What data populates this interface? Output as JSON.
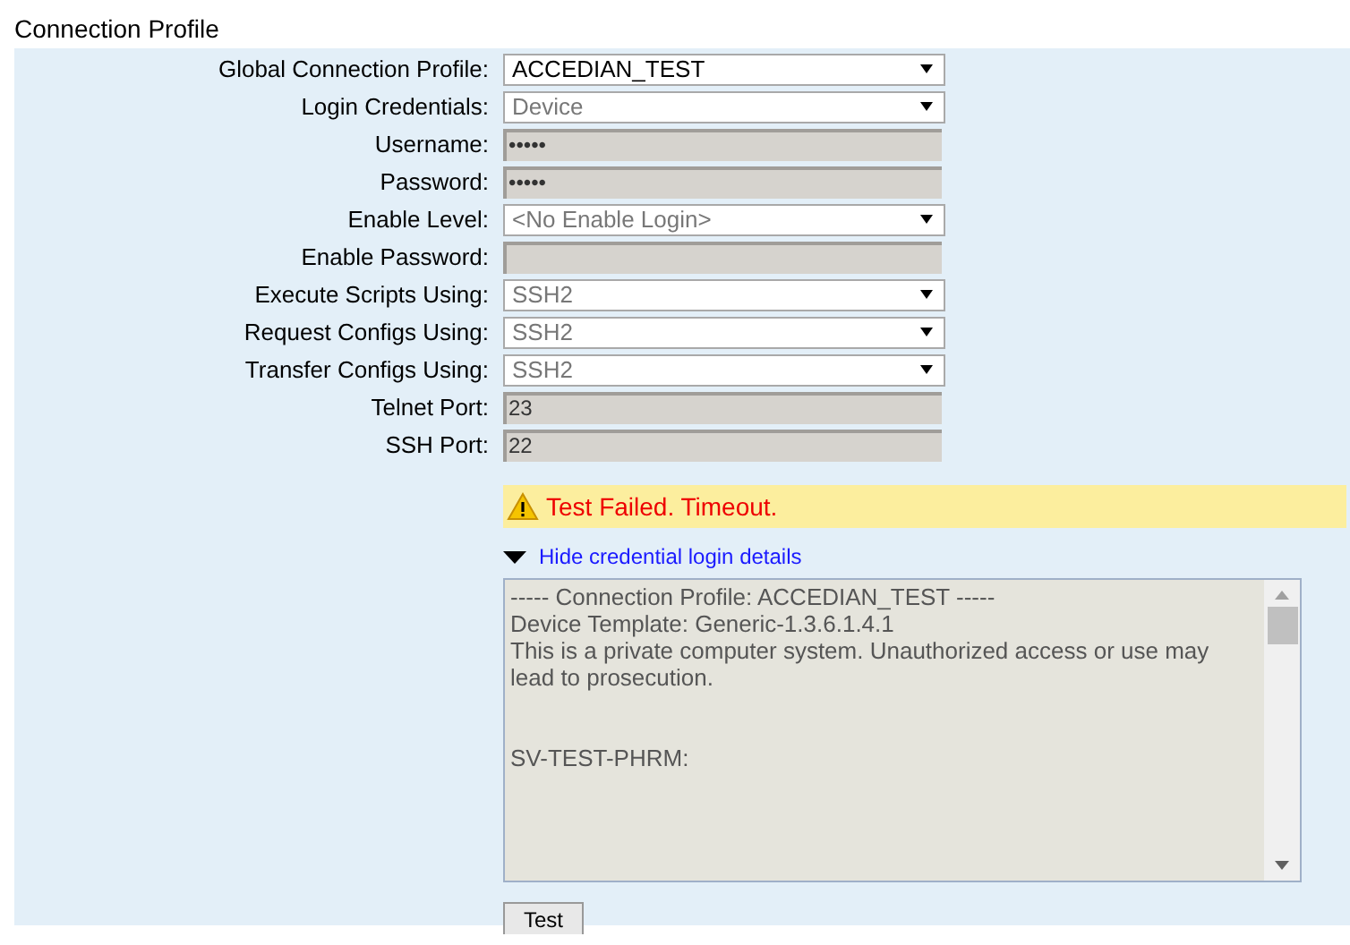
{
  "title": "Connection Profile",
  "fields": [
    {
      "label": "Global Connection Profile:",
      "kind": "select",
      "value": "ACCEDIAN_TEST",
      "disabled": false
    },
    {
      "label": "Login Credentials:",
      "kind": "select",
      "value": "Device",
      "disabled": true
    },
    {
      "label": "Username:",
      "kind": "input",
      "value": "•••••",
      "disabled": true
    },
    {
      "label": "Password:",
      "kind": "input",
      "value": "•••••",
      "disabled": true
    },
    {
      "label": "Enable Level:",
      "kind": "select",
      "value": "<No Enable Login>",
      "disabled": true
    },
    {
      "label": "Enable Password:",
      "kind": "input",
      "disabled": true
    },
    {
      "label": "Execute Scripts Using:",
      "kind": "select",
      "value": "SSH2",
      "disabled": true
    },
    {
      "label": "Request Configs Using:",
      "kind": "select",
      "value": "SSH2",
      "disabled": true
    },
    {
      "label": "Transfer Configs Using:",
      "kind": "select",
      "value": "SSH2",
      "disabled": true
    },
    {
      "label": "Telnet Port:",
      "kind": "input",
      "value": "23",
      "disabled": true
    },
    {
      "label": "SSH Port:",
      "kind": "input",
      "value": "22",
      "disabled": true
    }
  ],
  "alert": {
    "message": "Test Failed. Timeout."
  },
  "details": {
    "toggle": "Hide credential login details",
    "expanded": true,
    "lines": [
      {
        "kind": "text",
        "text": "----- Connection Profile: ACCEDIAN_TEST -----"
      },
      {
        "kind": "text",
        "text": "Device Template: Generic-1.3.6.1.4.1"
      },
      {
        "kind": "text",
        "text": "This is a private computer system. Unauthorized access or use may lead to prosecution."
      },
      {
        "kind": "prompt",
        "text": "SV-TEST-PHRM:"
      }
    ]
  },
  "buttons": [
    "Test"
  ]
}
